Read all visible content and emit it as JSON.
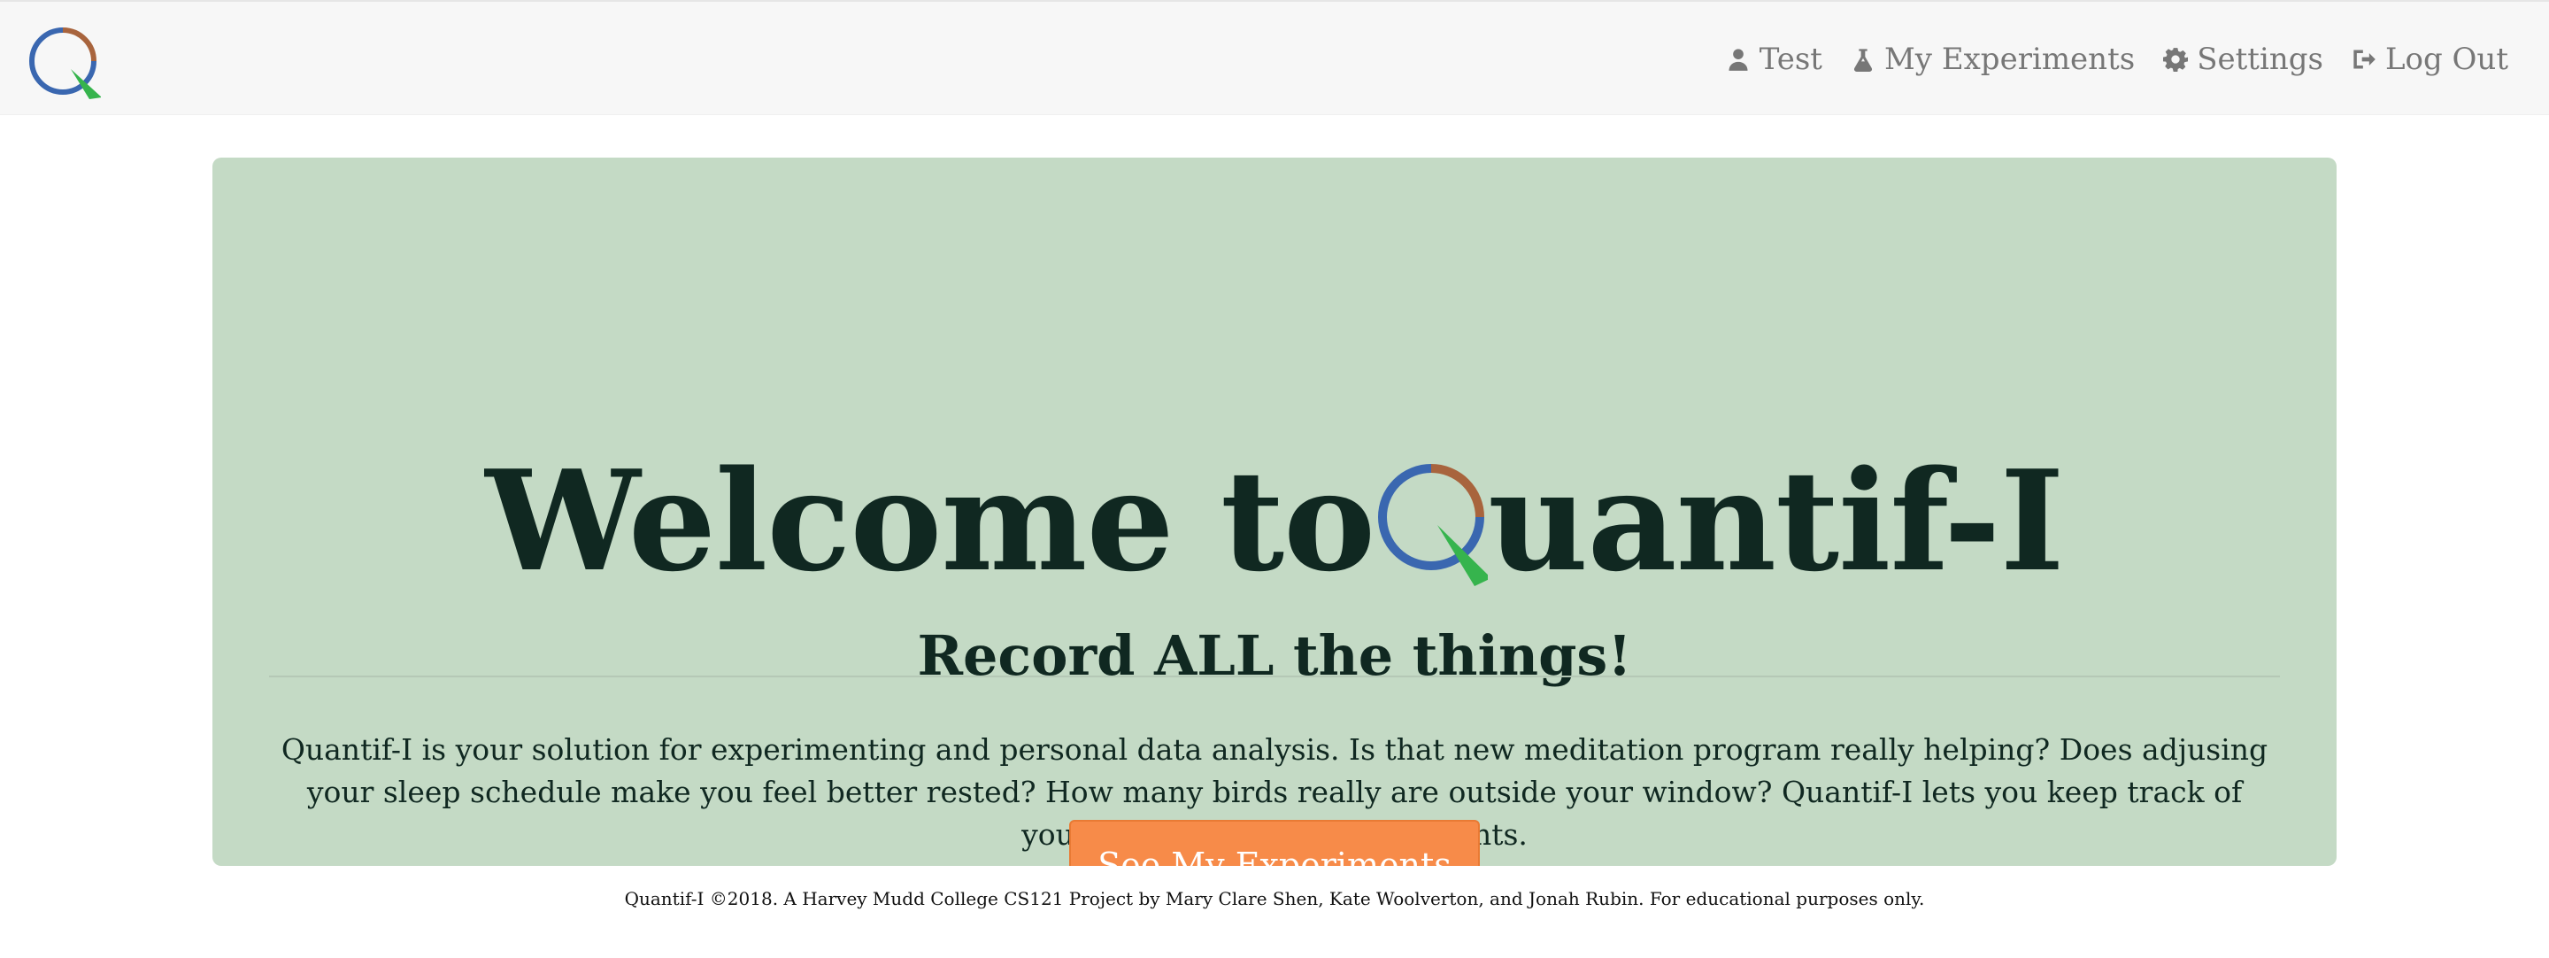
{
  "brand": {
    "logo_icon": "quantif-i-logo-icon",
    "colors": {
      "blue": "#3a67b0",
      "brown": "#a8643d",
      "green": "#36b44d"
    }
  },
  "nav": {
    "items": [
      {
        "label": "Test",
        "icon": "user-icon"
      },
      {
        "label": "My Experiments",
        "icon": "flask-icon"
      },
      {
        "label": "Settings",
        "icon": "gear-icon"
      },
      {
        "label": "Log Out",
        "icon": "logout-icon"
      }
    ]
  },
  "hero": {
    "title_prefix": "Welcome to ",
    "title_suffix": "uantif-I",
    "subtitle": "Record ALL the things!",
    "description": "Quantif-I is your solution for experimenting and personal data analysis. Is that new meditation program really helping? Does adjusing your sleep schedule make you feel better rested? How many birds really are outside your window? Quantif-I lets you keep track of your life and draw useful insights.",
    "button_label": "See My Experiments"
  },
  "footer": {
    "text": "Quantif-I ©2018. A Harvey Mudd College CS121 Project by Mary Clare Shen, Kate Woolverton, and Jonah Rubin. For educational purposes only."
  },
  "colors": {
    "hero_background": "#c4dac5",
    "button_background": "#f78b49",
    "nav_text": "#777777",
    "heading_text": "#102821"
  }
}
